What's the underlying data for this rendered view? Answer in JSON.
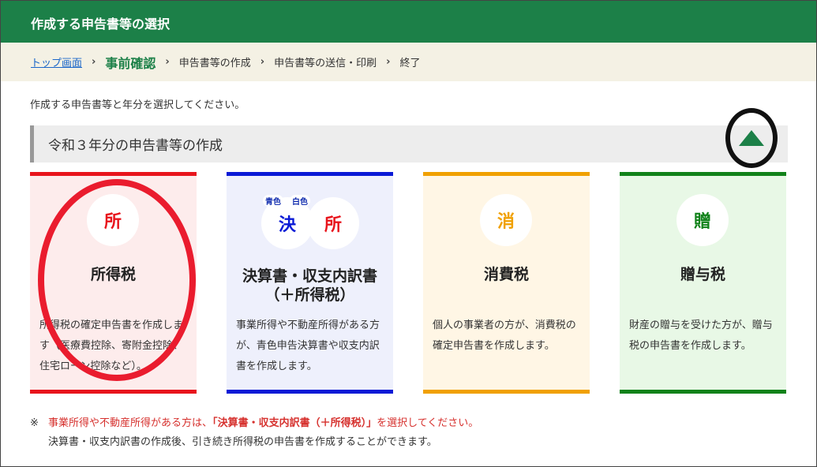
{
  "header": {
    "title": "作成する申告書等の選択"
  },
  "breadcrumb": {
    "home": "トップ画面",
    "steps": [
      "事前確認",
      "申告書等の作成",
      "申告書等の送信・印刷",
      "終了"
    ],
    "separator": "›"
  },
  "intro": "作成する申告書等と年分を選択してください。",
  "section": {
    "title": "令和３年分の申告書等の作成"
  },
  "cards": [
    {
      "badge": "所",
      "title": "所得税",
      "desc": "所得税の確定申告書を作成します（医療費控除、寄附金控除、住宅ローン控除など）。",
      "color": "#e8141c",
      "bg": "#fdecec"
    },
    {
      "tags": [
        "青色",
        "白色"
      ],
      "badge1": "決",
      "badge2": "所",
      "title1": "決算書・収支内訳書",
      "title2": "（＋所得税）",
      "desc": "事業所得や不動産所得がある方が、青色申告決算書や収支内訳書を作成します。",
      "color": "#0a1ad6",
      "bg": "#eef0fc"
    },
    {
      "badge": "消",
      "title": "消費税",
      "desc": "個人の事業者の方が、消費税の確定申告書を作成します。",
      "color": "#f0a000",
      "bg": "#fff6e5"
    },
    {
      "badge": "贈",
      "title": "贈与税",
      "desc": "財産の贈与を受けた方が、贈与税の申告書を作成します。",
      "color": "#11821a",
      "bg": "#e8f8e6"
    }
  ],
  "notes": {
    "mark": "※",
    "line1_pre": "事業所得や不動産所得がある方は、",
    "line1_link": "「決算書・収支内訳書（＋所得税）」",
    "line1_post": "を選択してください。",
    "line2": "決算書・収支内訳書の作成後、引き続き所得税の申告書を作成することができます。"
  },
  "icons": {
    "collapse": "triangle-up-icon"
  }
}
